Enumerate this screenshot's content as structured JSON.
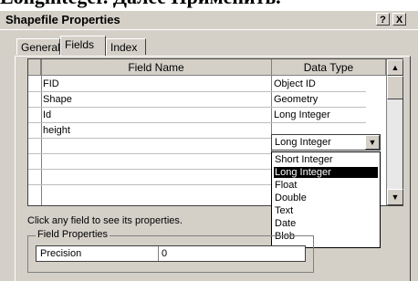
{
  "caption": "Longinteger. Далее Применить.",
  "window": {
    "title": "Shapefile Properties",
    "help_button": "?",
    "close_button": "X"
  },
  "tabs": [
    {
      "label": "General"
    },
    {
      "label": "Fields"
    },
    {
      "label": "Index"
    }
  ],
  "grid": {
    "columns": [
      "Field Name",
      "Data Type"
    ],
    "rows": [
      {
        "field": "FID",
        "type": "Object ID"
      },
      {
        "field": "Shape",
        "type": "Geometry"
      },
      {
        "field": "Id",
        "type": "Long Integer"
      },
      {
        "field": "height",
        "type": "Long Integer"
      }
    ]
  },
  "dropdown": {
    "value": "Long Integer",
    "options": [
      "Short Integer",
      "Long Integer",
      "Float",
      "Double",
      "Text",
      "Date",
      "Blob"
    ],
    "selected": "Long Integer"
  },
  "help_text": "Click any field to see its properties.",
  "field_properties": {
    "legend": "Field Properties",
    "rows": [
      {
        "label": "Precision",
        "value": "0"
      }
    ]
  },
  "colors": {
    "face": "#d4d0c8",
    "shadow": "#404040",
    "highlight": "#ffffff",
    "selection": "#000000"
  }
}
